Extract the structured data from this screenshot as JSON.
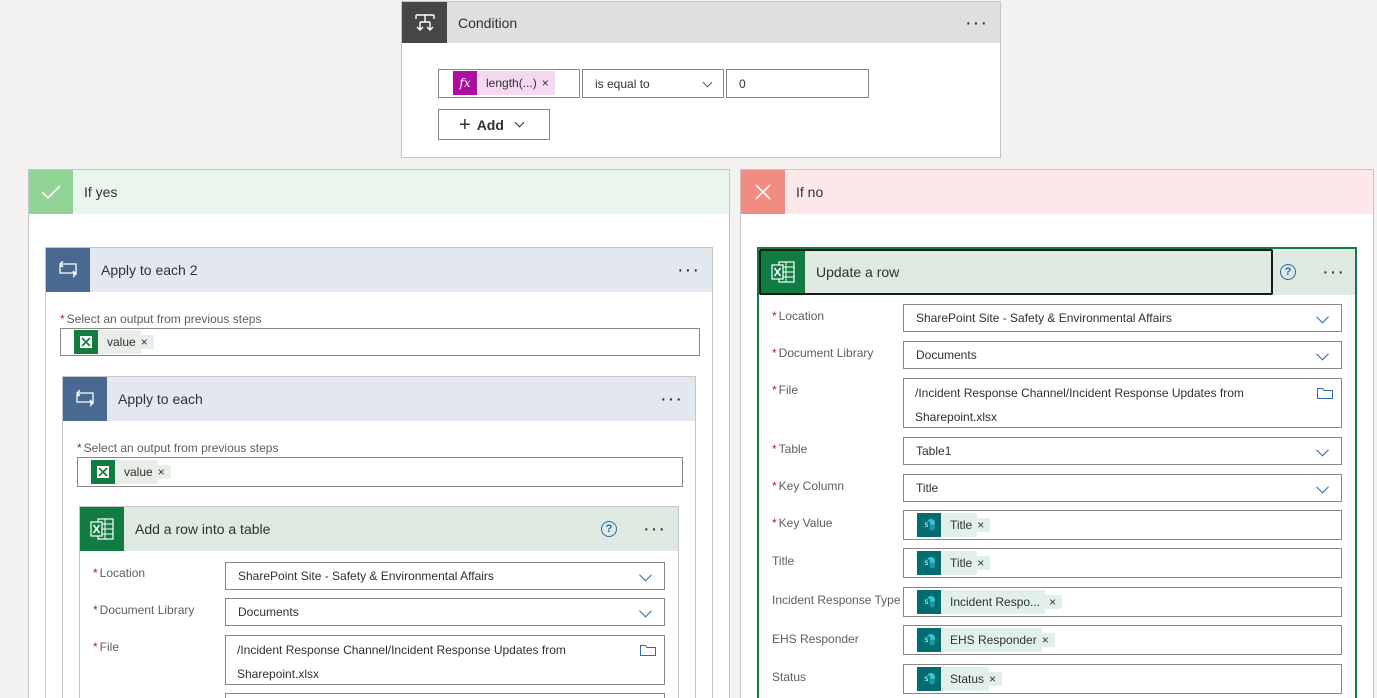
{
  "condition": {
    "title": "Condition",
    "expression": "length(...)",
    "operator": "is equal to",
    "value": "0",
    "add_label": "Add"
  },
  "if_yes": {
    "title": "If yes",
    "apply2": {
      "title": "Apply to each 2",
      "output_label": "Select an output from previous steps",
      "token": "value"
    },
    "apply1": {
      "title": "Apply to each",
      "output_label": "Select an output from previous steps",
      "token": "value"
    },
    "add_row": {
      "title": "Add a row into a table",
      "location_label": "Location",
      "location_value": "SharePoint Site - Safety & Environmental Affairs",
      "library_label": "Document Library",
      "library_value": "Documents",
      "file_label": "File",
      "file_value_line1": "/Incident Response Channel/Incident Response Updates from",
      "file_value_line2": "Sharepoint.xlsx"
    }
  },
  "if_no": {
    "title": "If no",
    "update_row": {
      "title": "Update a row",
      "location_label": "Location",
      "location_value": "SharePoint Site - Safety & Environmental Affairs",
      "library_label": "Document Library",
      "library_value": "Documents",
      "file_label": "File",
      "file_value_line1": "/Incident Response Channel/Incident Response Updates from",
      "file_value_line2": "Sharepoint.xlsx",
      "table_label": "Table",
      "table_value": "Table1",
      "key_column_label": "Key Column",
      "key_column_value": "Title",
      "key_value_label": "Key Value",
      "key_value_token": "Title",
      "title_label": "Title",
      "title_token": "Title",
      "irt_label": "Incident Response Type",
      "irt_token": "Incident Respo...",
      "ehs_label": "EHS Responder",
      "ehs_token": "EHS Responder",
      "status_label": "Status",
      "status_token": "Status"
    }
  },
  "colors": {
    "condition_header": "#484644",
    "loop_header": "#486991",
    "excel_green": "#107c41",
    "yes_green": "#92d396",
    "no_red": "#f28b82",
    "sharepoint_teal": "#036c70",
    "expression_magenta": "#ad0e9f"
  }
}
